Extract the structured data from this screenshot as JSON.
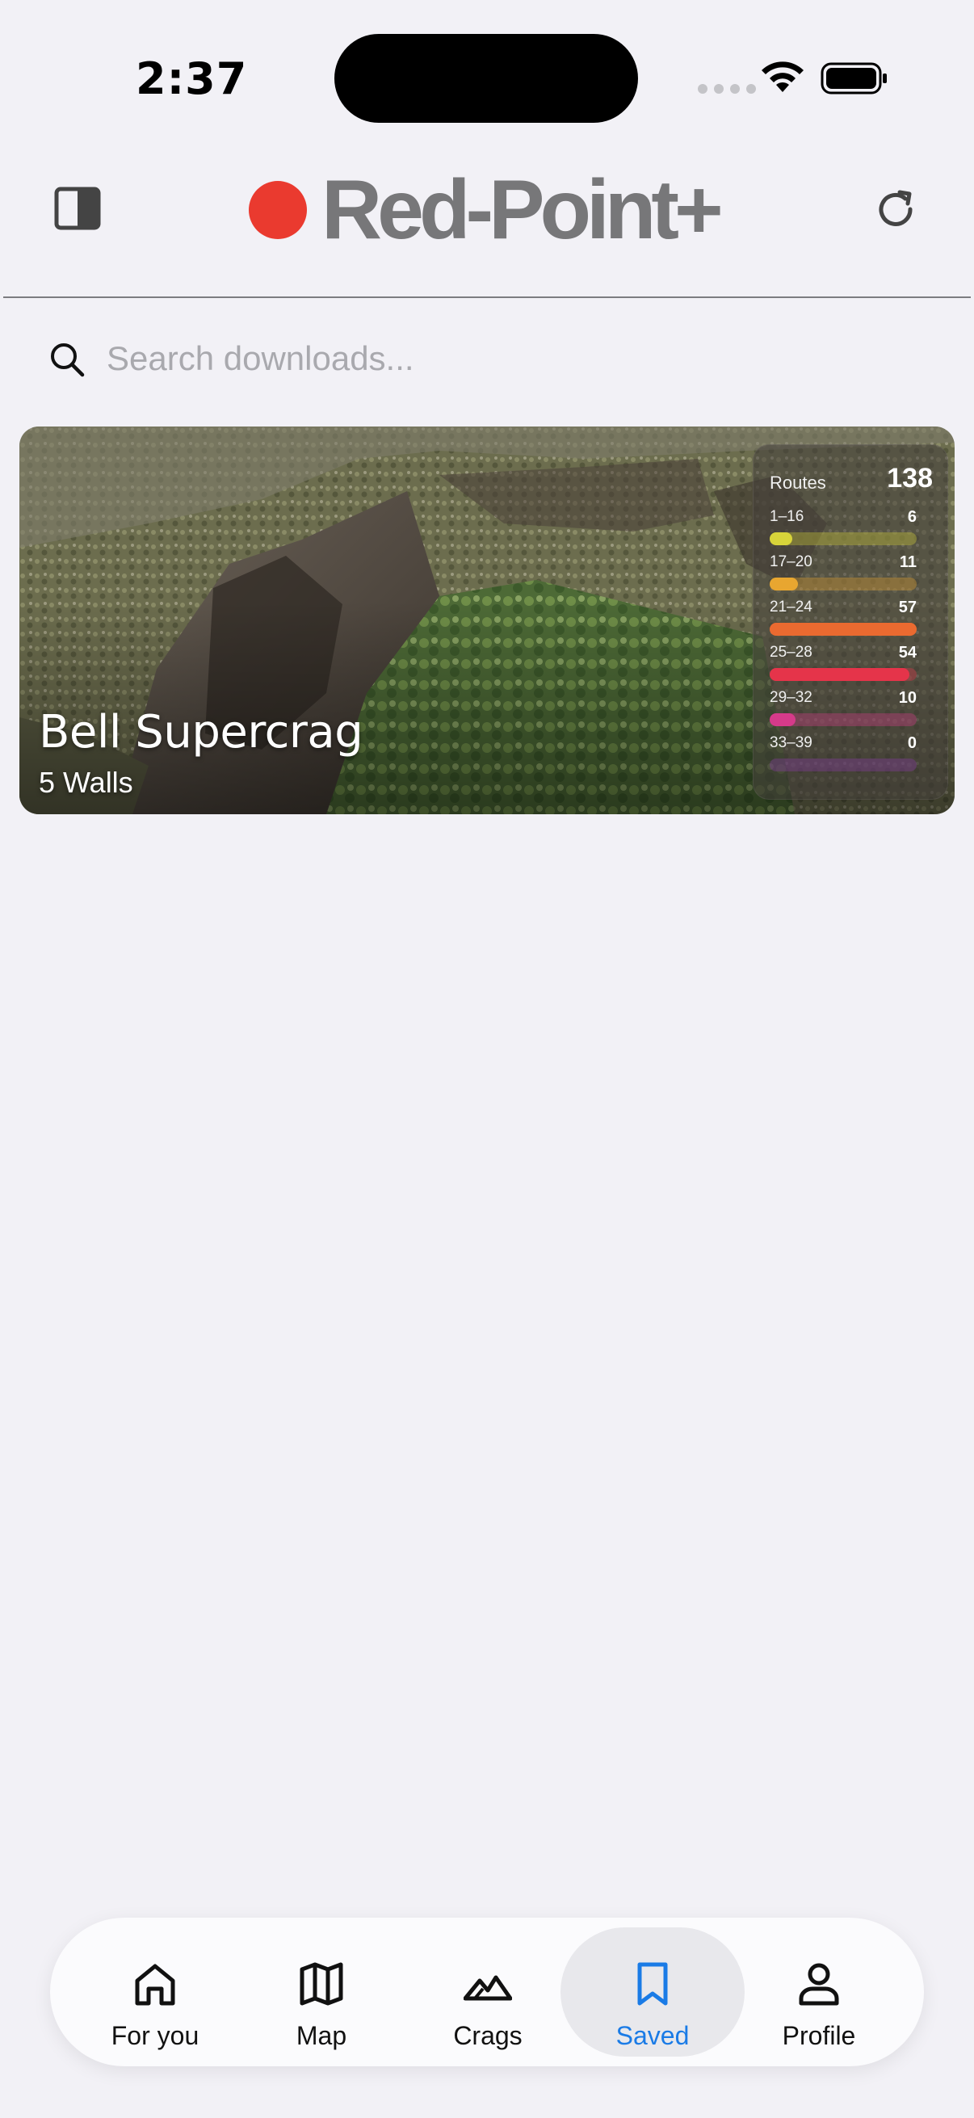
{
  "status_bar": {
    "time": "2:37"
  },
  "header": {
    "logo_text": "Red-Point+",
    "brand_color": "#ea3a2f",
    "left_icon": "sidebar-toggle-icon",
    "right_icon": "refresh-icon"
  },
  "search": {
    "placeholder": "Search downloads...",
    "value": ""
  },
  "downloads": [
    {
      "title": "Bell Supercrag",
      "subtitle": "5 Walls",
      "routes_label": "Routes",
      "routes_total": "138",
      "grades": [
        {
          "label": "1–16",
          "count": "6",
          "color": "#d8d43a",
          "fraction": 0.105
        },
        {
          "label": "17–20",
          "count": "11",
          "color": "#e8a630",
          "fraction": 0.19
        },
        {
          "label": "21–24",
          "count": "57",
          "color": "#ea6a30",
          "fraction": 1.0
        },
        {
          "label": "25–28",
          "count": "54",
          "color": "#e5344a",
          "fraction": 0.95
        },
        {
          "label": "29–32",
          "count": "10",
          "color": "#d63a8a",
          "fraction": 0.175
        },
        {
          "label": "33–39",
          "count": "0",
          "color": "#8a3aa8",
          "fraction": 0.0
        }
      ]
    }
  ],
  "tab_bar": {
    "active": "Saved",
    "tabs": [
      {
        "label": "For you",
        "icon": "home-icon"
      },
      {
        "label": "Map",
        "icon": "map-icon"
      },
      {
        "label": "Crags",
        "icon": "mountains-icon"
      },
      {
        "label": "Saved",
        "icon": "bookmark-icon"
      },
      {
        "label": "Profile",
        "icon": "person-icon"
      }
    ]
  }
}
